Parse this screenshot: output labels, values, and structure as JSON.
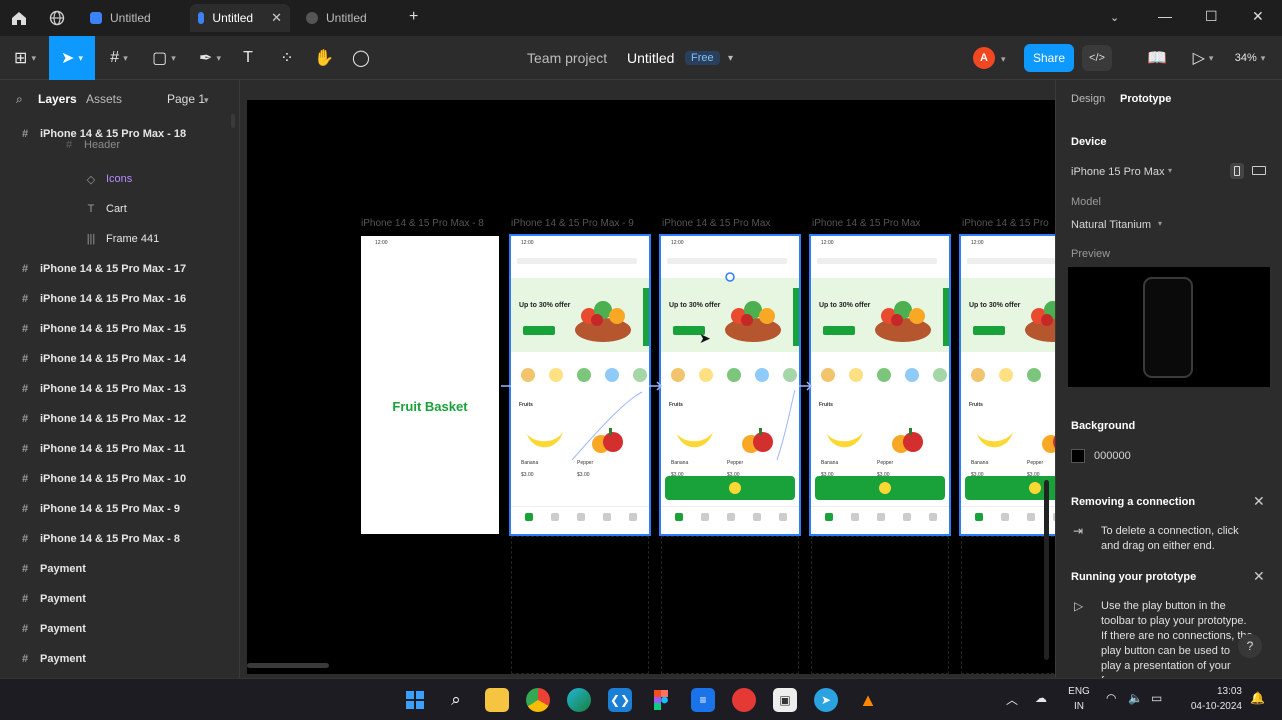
{
  "tabs": [
    {
      "label": "Untitled",
      "active": false
    },
    {
      "label": "Untitled",
      "active": true
    },
    {
      "label": "Untitled",
      "active": false
    }
  ],
  "header": {
    "team": "Team project",
    "file": "Untitled",
    "plan": "Free",
    "avatar": "A",
    "share": "Share",
    "dev_mode": "</>",
    "zoom": "34%"
  },
  "left_panel": {
    "tab_layers": "Layers",
    "tab_assets": "Assets",
    "page": "Page 1",
    "layers": [
      {
        "label": "iPhone 14 & 15 Pro Max - 18",
        "indent": 0,
        "bold": true,
        "glyph": "#"
      },
      {
        "label": "Header",
        "indent": 2,
        "bold": false,
        "glyph": "#"
      },
      {
        "label": "Icons",
        "indent": 3,
        "bold": false,
        "glyph": "◇",
        "component": true
      },
      {
        "label": "Cart",
        "indent": 3,
        "bold": false,
        "glyph": "T"
      },
      {
        "label": "Frame 441",
        "indent": 3,
        "bold": false,
        "glyph": "|||"
      },
      {
        "label": "iPhone 14 & 15 Pro Max - 17",
        "indent": 0,
        "bold": true,
        "glyph": "#"
      },
      {
        "label": "iPhone 14 & 15 Pro Max - 16",
        "indent": 0,
        "bold": true,
        "glyph": "#"
      },
      {
        "label": "iPhone 14 & 15 Pro Max - 15",
        "indent": 0,
        "bold": true,
        "glyph": "#"
      },
      {
        "label": "iPhone 14 & 15 Pro Max - 14",
        "indent": 0,
        "bold": true,
        "glyph": "#"
      },
      {
        "label": "iPhone 14 & 15 Pro Max - 13",
        "indent": 0,
        "bold": true,
        "glyph": "#"
      },
      {
        "label": "iPhone 14 & 15 Pro Max - 12",
        "indent": 0,
        "bold": true,
        "glyph": "#"
      },
      {
        "label": "iPhone 14 & 15 Pro Max - 11",
        "indent": 0,
        "bold": true,
        "glyph": "#"
      },
      {
        "label": "iPhone 14 & 15 Pro Max - 10",
        "indent": 0,
        "bold": true,
        "glyph": "#"
      },
      {
        "label": "iPhone 14 & 15 Pro Max - 9",
        "indent": 0,
        "bold": true,
        "glyph": "#"
      },
      {
        "label": "iPhone 14 & 15 Pro Max - 8",
        "indent": 0,
        "bold": true,
        "glyph": "#"
      },
      {
        "label": "Payment",
        "indent": 0,
        "bold": true,
        "glyph": "#"
      },
      {
        "label": "Payment",
        "indent": 0,
        "bold": true,
        "glyph": "#"
      },
      {
        "label": "Payment",
        "indent": 0,
        "bold": true,
        "glyph": "#"
      },
      {
        "label": "Payment",
        "indent": 0,
        "bold": true,
        "glyph": "#"
      }
    ]
  },
  "canvas": {
    "frame_labels": [
      "iPhone 14 & 15 Pro Max - 8",
      "iPhone 14 & 15 Pro Max - 9",
      "iPhone 14 & 15 Pro Max",
      "iPhone 14 & 15 Pro Max",
      "iPhone 14 & 15 Pro"
    ],
    "splash_title": "Fruit Basket",
    "hero_text": "Up to 30% offer",
    "section": "Fruits",
    "product_1": "Banana",
    "product_2": "Pepper",
    "price": "$3.00",
    "time": "12:00"
  },
  "right_panel": {
    "tab_design": "Design",
    "tab_prototype": "Prototype",
    "device_heading": "Device",
    "device": "iPhone 15 Pro Max",
    "model_label": "Model",
    "model": "Natural Titanium",
    "preview_label": "Preview",
    "background_heading": "Background",
    "background_value": "000000",
    "tip1_title": "Removing a connection",
    "tip1_text": "To delete a connection, click and drag on either end.",
    "tip2_title": "Running your prototype",
    "tip2_text": "Use the play button in the toolbar to play your prototype. If there are no connections, the play button can be used to play a presentation of your frames.",
    "help": "?"
  },
  "taskbar": {
    "lang_1": "ENG",
    "lang_2": "IN",
    "time": "13:03",
    "date": "04-10-2024"
  },
  "colors": {
    "accent": "#0d99ff",
    "brand_green": "#19a13a",
    "canvas": "#000000",
    "panel": "#2c2c2c"
  }
}
